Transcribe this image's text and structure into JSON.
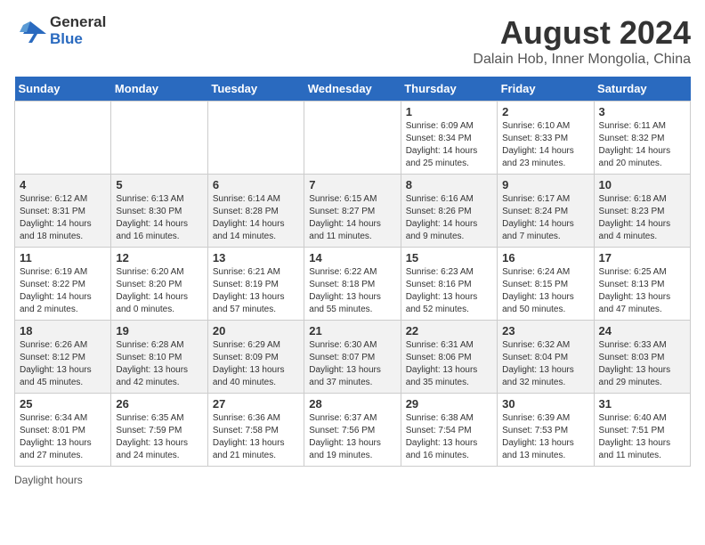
{
  "logo": {
    "line1": "General",
    "line2": "Blue"
  },
  "title": "August 2024",
  "subtitle": "Dalain Hob, Inner Mongolia, China",
  "weekdays": [
    "Sunday",
    "Monday",
    "Tuesday",
    "Wednesday",
    "Thursday",
    "Friday",
    "Saturday"
  ],
  "weeks": [
    [
      {
        "day": "",
        "info": ""
      },
      {
        "day": "",
        "info": ""
      },
      {
        "day": "",
        "info": ""
      },
      {
        "day": "",
        "info": ""
      },
      {
        "day": "1",
        "info": "Sunrise: 6:09 AM\nSunset: 8:34 PM\nDaylight: 14 hours and 25 minutes."
      },
      {
        "day": "2",
        "info": "Sunrise: 6:10 AM\nSunset: 8:33 PM\nDaylight: 14 hours and 23 minutes."
      },
      {
        "day": "3",
        "info": "Sunrise: 6:11 AM\nSunset: 8:32 PM\nDaylight: 14 hours and 20 minutes."
      }
    ],
    [
      {
        "day": "4",
        "info": "Sunrise: 6:12 AM\nSunset: 8:31 PM\nDaylight: 14 hours and 18 minutes."
      },
      {
        "day": "5",
        "info": "Sunrise: 6:13 AM\nSunset: 8:30 PM\nDaylight: 14 hours and 16 minutes."
      },
      {
        "day": "6",
        "info": "Sunrise: 6:14 AM\nSunset: 8:28 PM\nDaylight: 14 hours and 14 minutes."
      },
      {
        "day": "7",
        "info": "Sunrise: 6:15 AM\nSunset: 8:27 PM\nDaylight: 14 hours and 11 minutes."
      },
      {
        "day": "8",
        "info": "Sunrise: 6:16 AM\nSunset: 8:26 PM\nDaylight: 14 hours and 9 minutes."
      },
      {
        "day": "9",
        "info": "Sunrise: 6:17 AM\nSunset: 8:24 PM\nDaylight: 14 hours and 7 minutes."
      },
      {
        "day": "10",
        "info": "Sunrise: 6:18 AM\nSunset: 8:23 PM\nDaylight: 14 hours and 4 minutes."
      }
    ],
    [
      {
        "day": "11",
        "info": "Sunrise: 6:19 AM\nSunset: 8:22 PM\nDaylight: 14 hours and 2 minutes."
      },
      {
        "day": "12",
        "info": "Sunrise: 6:20 AM\nSunset: 8:20 PM\nDaylight: 14 hours and 0 minutes."
      },
      {
        "day": "13",
        "info": "Sunrise: 6:21 AM\nSunset: 8:19 PM\nDaylight: 13 hours and 57 minutes."
      },
      {
        "day": "14",
        "info": "Sunrise: 6:22 AM\nSunset: 8:18 PM\nDaylight: 13 hours and 55 minutes."
      },
      {
        "day": "15",
        "info": "Sunrise: 6:23 AM\nSunset: 8:16 PM\nDaylight: 13 hours and 52 minutes."
      },
      {
        "day": "16",
        "info": "Sunrise: 6:24 AM\nSunset: 8:15 PM\nDaylight: 13 hours and 50 minutes."
      },
      {
        "day": "17",
        "info": "Sunrise: 6:25 AM\nSunset: 8:13 PM\nDaylight: 13 hours and 47 minutes."
      }
    ],
    [
      {
        "day": "18",
        "info": "Sunrise: 6:26 AM\nSunset: 8:12 PM\nDaylight: 13 hours and 45 minutes."
      },
      {
        "day": "19",
        "info": "Sunrise: 6:28 AM\nSunset: 8:10 PM\nDaylight: 13 hours and 42 minutes."
      },
      {
        "day": "20",
        "info": "Sunrise: 6:29 AM\nSunset: 8:09 PM\nDaylight: 13 hours and 40 minutes."
      },
      {
        "day": "21",
        "info": "Sunrise: 6:30 AM\nSunset: 8:07 PM\nDaylight: 13 hours and 37 minutes."
      },
      {
        "day": "22",
        "info": "Sunrise: 6:31 AM\nSunset: 8:06 PM\nDaylight: 13 hours and 35 minutes."
      },
      {
        "day": "23",
        "info": "Sunrise: 6:32 AM\nSunset: 8:04 PM\nDaylight: 13 hours and 32 minutes."
      },
      {
        "day": "24",
        "info": "Sunrise: 6:33 AM\nSunset: 8:03 PM\nDaylight: 13 hours and 29 minutes."
      }
    ],
    [
      {
        "day": "25",
        "info": "Sunrise: 6:34 AM\nSunset: 8:01 PM\nDaylight: 13 hours and 27 minutes."
      },
      {
        "day": "26",
        "info": "Sunrise: 6:35 AM\nSunset: 7:59 PM\nDaylight: 13 hours and 24 minutes."
      },
      {
        "day": "27",
        "info": "Sunrise: 6:36 AM\nSunset: 7:58 PM\nDaylight: 13 hours and 21 minutes."
      },
      {
        "day": "28",
        "info": "Sunrise: 6:37 AM\nSunset: 7:56 PM\nDaylight: 13 hours and 19 minutes."
      },
      {
        "day": "29",
        "info": "Sunrise: 6:38 AM\nSunset: 7:54 PM\nDaylight: 13 hours and 16 minutes."
      },
      {
        "day": "30",
        "info": "Sunrise: 6:39 AM\nSunset: 7:53 PM\nDaylight: 13 hours and 13 minutes."
      },
      {
        "day": "31",
        "info": "Sunrise: 6:40 AM\nSunset: 7:51 PM\nDaylight: 13 hours and 11 minutes."
      }
    ]
  ],
  "footer": "Daylight hours"
}
